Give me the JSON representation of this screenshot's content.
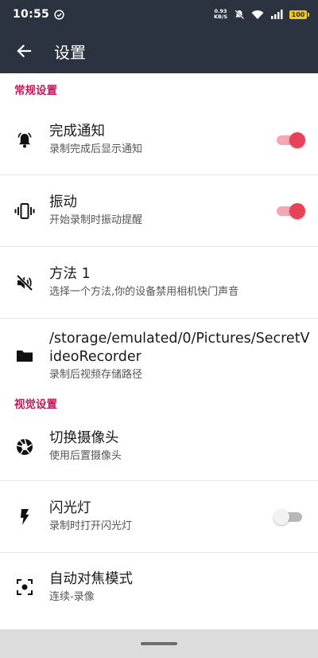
{
  "status_bar": {
    "time": "10:55",
    "net_speed_value": "0.93",
    "net_speed_unit": "KB/S",
    "battery": "100"
  },
  "app_bar": {
    "title": "设置"
  },
  "sections": {
    "general": {
      "header": "常规设置",
      "completion_notice": {
        "title": "完成通知",
        "subtitle": "录制完成后显示通知",
        "enabled": true
      },
      "vibration": {
        "title": "振动",
        "subtitle": "开始录制时振动提醒",
        "enabled": true
      },
      "method": {
        "title": "方法 1",
        "subtitle": "选择一个方法,你的设备禁用相机快门声音"
      },
      "storage_path": {
        "title": "/storage/emulated/0/Pictures/SecretVideoRecorder",
        "subtitle": "录制后视频存储路径"
      }
    },
    "visual": {
      "header": "视觉设置",
      "switch_camera": {
        "title": "切换摄像头",
        "subtitle": "使用后置摄像头"
      },
      "flash": {
        "title": "闪光灯",
        "subtitle": "录制时打开闪光灯",
        "enabled": false
      },
      "autofocus": {
        "title": "自动对焦模式",
        "subtitle": "连续-录像"
      }
    }
  },
  "colors": {
    "bar": "#2c3340",
    "accent": "#e8415a",
    "section_header": "#c2185b"
  },
  "icons": [
    "check-circle-icon",
    "wifi-icon",
    "signal-icon",
    "back-arrow-icon",
    "bell-icon",
    "vibrate-icon",
    "volume-off-icon",
    "folder-icon",
    "aperture-icon",
    "flash-icon",
    "focus-icon"
  ]
}
